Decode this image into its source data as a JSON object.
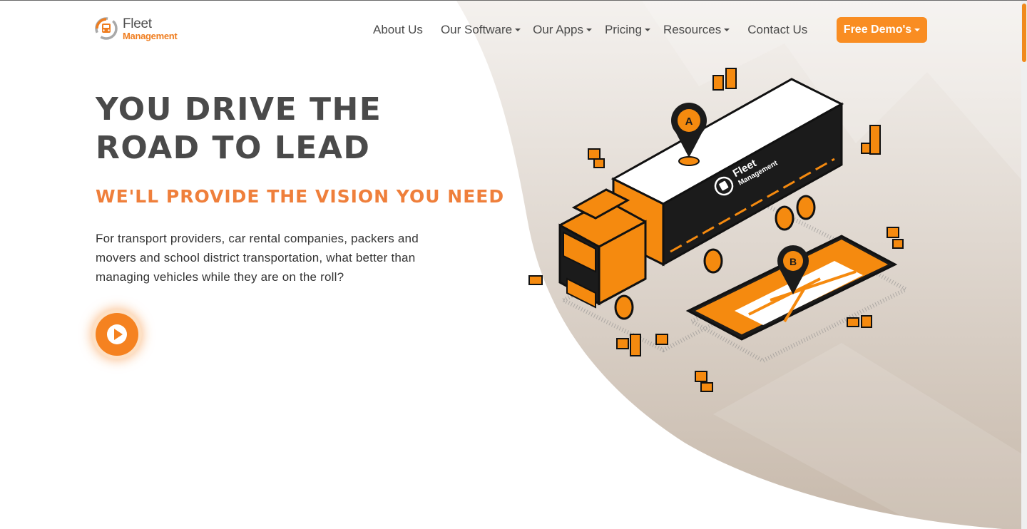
{
  "brand": {
    "line1": "Fleet",
    "line2": "Management",
    "accent_color": "#f98d22"
  },
  "nav": {
    "items": [
      {
        "label": "About Us",
        "has_dropdown": false
      },
      {
        "label": "Our Software",
        "has_dropdown": true
      },
      {
        "label": "Our Apps",
        "has_dropdown": true
      },
      {
        "label": "Pricing",
        "has_dropdown": true
      },
      {
        "label": "Resources",
        "has_dropdown": true
      },
      {
        "label": "Contact Us",
        "has_dropdown": false
      }
    ],
    "cta_label": "Free Demo's"
  },
  "hero": {
    "title": "YOU DRIVE THE ROAD TO LEAD",
    "subtitle": "WE'LL PROVIDE THE VISION YOU NEED",
    "description": "For transport providers, car rental companies, packers and movers and school district transportation, what better than managing vehicles while they are on the roll?",
    "play_icon": "play-icon"
  },
  "illustration": {
    "truck_brand_line1": "Fleet",
    "truck_brand_line2": "Management",
    "pin_a": "A",
    "pin_b": "B"
  }
}
